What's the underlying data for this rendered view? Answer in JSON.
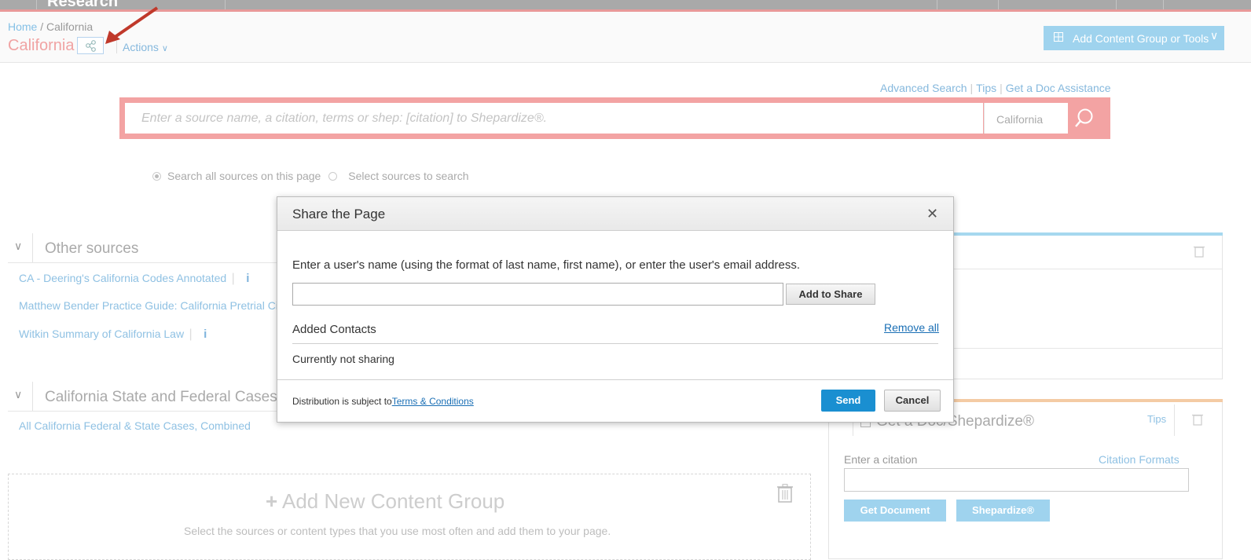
{
  "top_nav": {
    "tab_label": "Research"
  },
  "header": {
    "breadcrumb_home": "Home",
    "breadcrumb_sep": "/",
    "breadcrumb_current": "California",
    "title": "California",
    "actions_label": "Actions",
    "add_group_label": "Add Content Group or Tools"
  },
  "search": {
    "links": [
      "Advanced Search",
      "Tips",
      "Get a Doc Assistance"
    ],
    "placeholder": "Enter a source name, a citation, terms or shep: [citation] to Shepardize®.",
    "scope": "California",
    "radio_all": "Search all sources on this page",
    "radio_select": "Select sources to search"
  },
  "groups": {
    "other_sources": {
      "title": "Other sources",
      "items": [
        "CA - Deering's California Codes Annotated",
        "Matthew Bender Practice Guide: California Pretrial Ci",
        "Witkin Summary of California Law"
      ]
    },
    "cases": {
      "title": "California State and Federal Cases",
      "items": [
        "All California Federal & State Cases, Combined"
      ]
    },
    "add_new": {
      "title": "Add New Content Group",
      "description": "Select the sources or content types that you use most often and add them to your page."
    }
  },
  "get_doc_widget": {
    "title": "Get a Doc/Shepardize®",
    "tips": "Tips",
    "citation_label": "Enter a citation",
    "citation_formats": "Citation Formats",
    "get_document": "Get Document",
    "shepardize": "Shepardize®"
  },
  "modal": {
    "title": "Share the Page",
    "instructions": "Enter a user's name (using the format of last name, first name), or enter the user's email address.",
    "input_value": "",
    "add_to_share": "Add to Share",
    "added_contacts": "Added Contacts",
    "remove_all": "Remove all",
    "status": "Currently not sharing",
    "distribution": "Distribution is subject to",
    "terms": "Terms & Conditions",
    "send": "Send",
    "cancel": "Cancel"
  },
  "colors": {
    "brand_pink": "#f3a3a3",
    "accent_blue": "#9fd3ee",
    "send_blue": "#1a8fd1",
    "link_blue": "#1a6fb5",
    "arrow_red": "#c0392b"
  }
}
